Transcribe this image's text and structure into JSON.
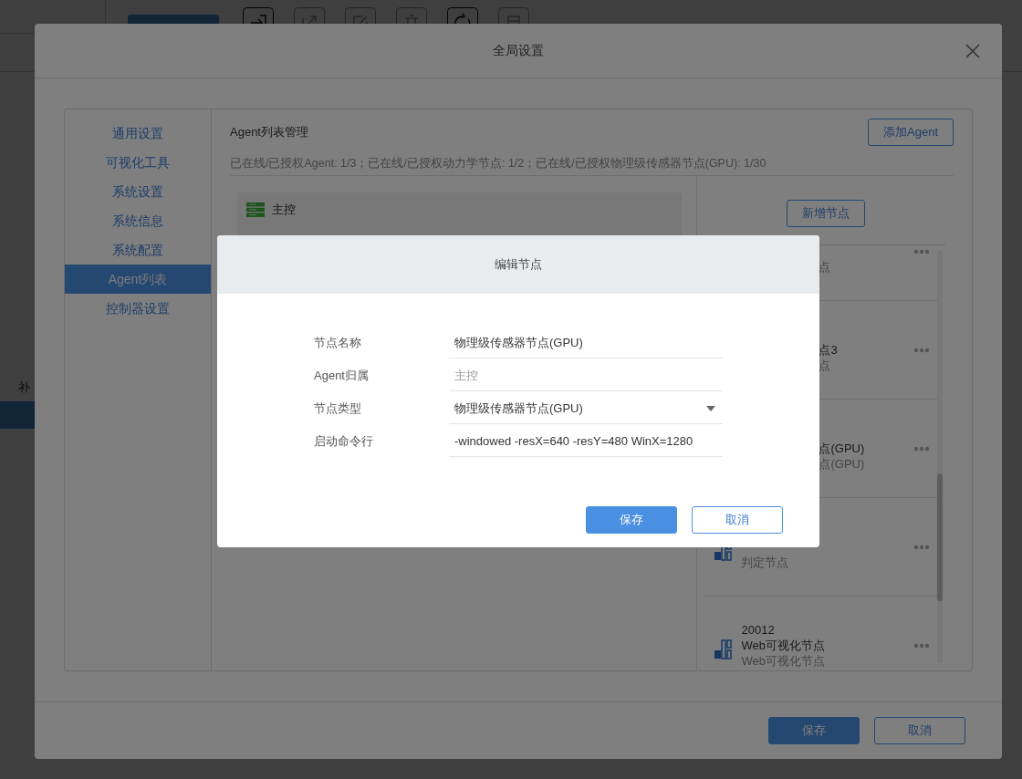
{
  "background_app": {
    "toolbar": [
      {
        "kind": "enter"
      },
      {
        "kind": "export"
      },
      {
        "kind": "edit"
      },
      {
        "kind": "delete"
      },
      {
        "kind": "refresh"
      },
      {
        "kind": "database"
      }
    ],
    "sidebar_items": [
      {
        "label": "补",
        "selected": false
      },
      {
        "selected": true
      }
    ]
  },
  "settings_dialog": {
    "title": "全局设置",
    "nav": [
      {
        "label": "通用设置",
        "selected": false
      },
      {
        "label": "可视化工具",
        "selected": false
      },
      {
        "label": "系统设置",
        "selected": false
      },
      {
        "label": "系统信息",
        "selected": false
      },
      {
        "label": "系统配置",
        "selected": false
      },
      {
        "label": "Agent列表",
        "selected": true
      },
      {
        "label": "控制器设置",
        "selected": false
      }
    ],
    "section_title": "Agent列表管理",
    "add_agent_button": "添加Agent",
    "stats": "已在线/已授权Agent: 1/3；已在线/已授权动力学节点: 1/2；已在线/已授权物理级传感器节点(GPU): 1/30",
    "agent_card": {
      "name": "主控"
    },
    "add_node_button": "新增节点",
    "nodes": [
      {
        "kind": "covered",
        "type": "点"
      },
      {
        "kind": "covered",
        "name": "点3",
        "type": "点"
      },
      {
        "kind": "covered",
        "name": "点(GPU)",
        "type": "点(GPU)"
      },
      {
        "kind": "judge",
        "type": "判定节点"
      },
      {
        "kind": "web",
        "id": "20012",
        "name": "Web可视化节点",
        "type": "Web可视化节点"
      }
    ],
    "buttons": [
      {
        "label": "保存",
        "primary": true
      },
      {
        "label": "取消",
        "primary": false
      }
    ]
  },
  "edit_dialog": {
    "title": "编辑节点",
    "fields": [
      {
        "kind": "text",
        "label": "节点名称",
        "value": "物理级传感器节点(GPU)",
        "disabled": false
      },
      {
        "kind": "text",
        "label": "Agent归属",
        "value": "主控",
        "disabled": true
      },
      {
        "kind": "select",
        "label": "节点类型",
        "value": "物理级传感器节点(GPU)",
        "disabled": false
      },
      {
        "kind": "text",
        "label": "启动命令行",
        "value": "-windowed -resX=640 -resY=480 WinX=1280",
        "disabled": false
      }
    ],
    "buttons": [
      {
        "label": "保存",
        "primary": true
      },
      {
        "label": "取消",
        "primary": false
      }
    ]
  }
}
